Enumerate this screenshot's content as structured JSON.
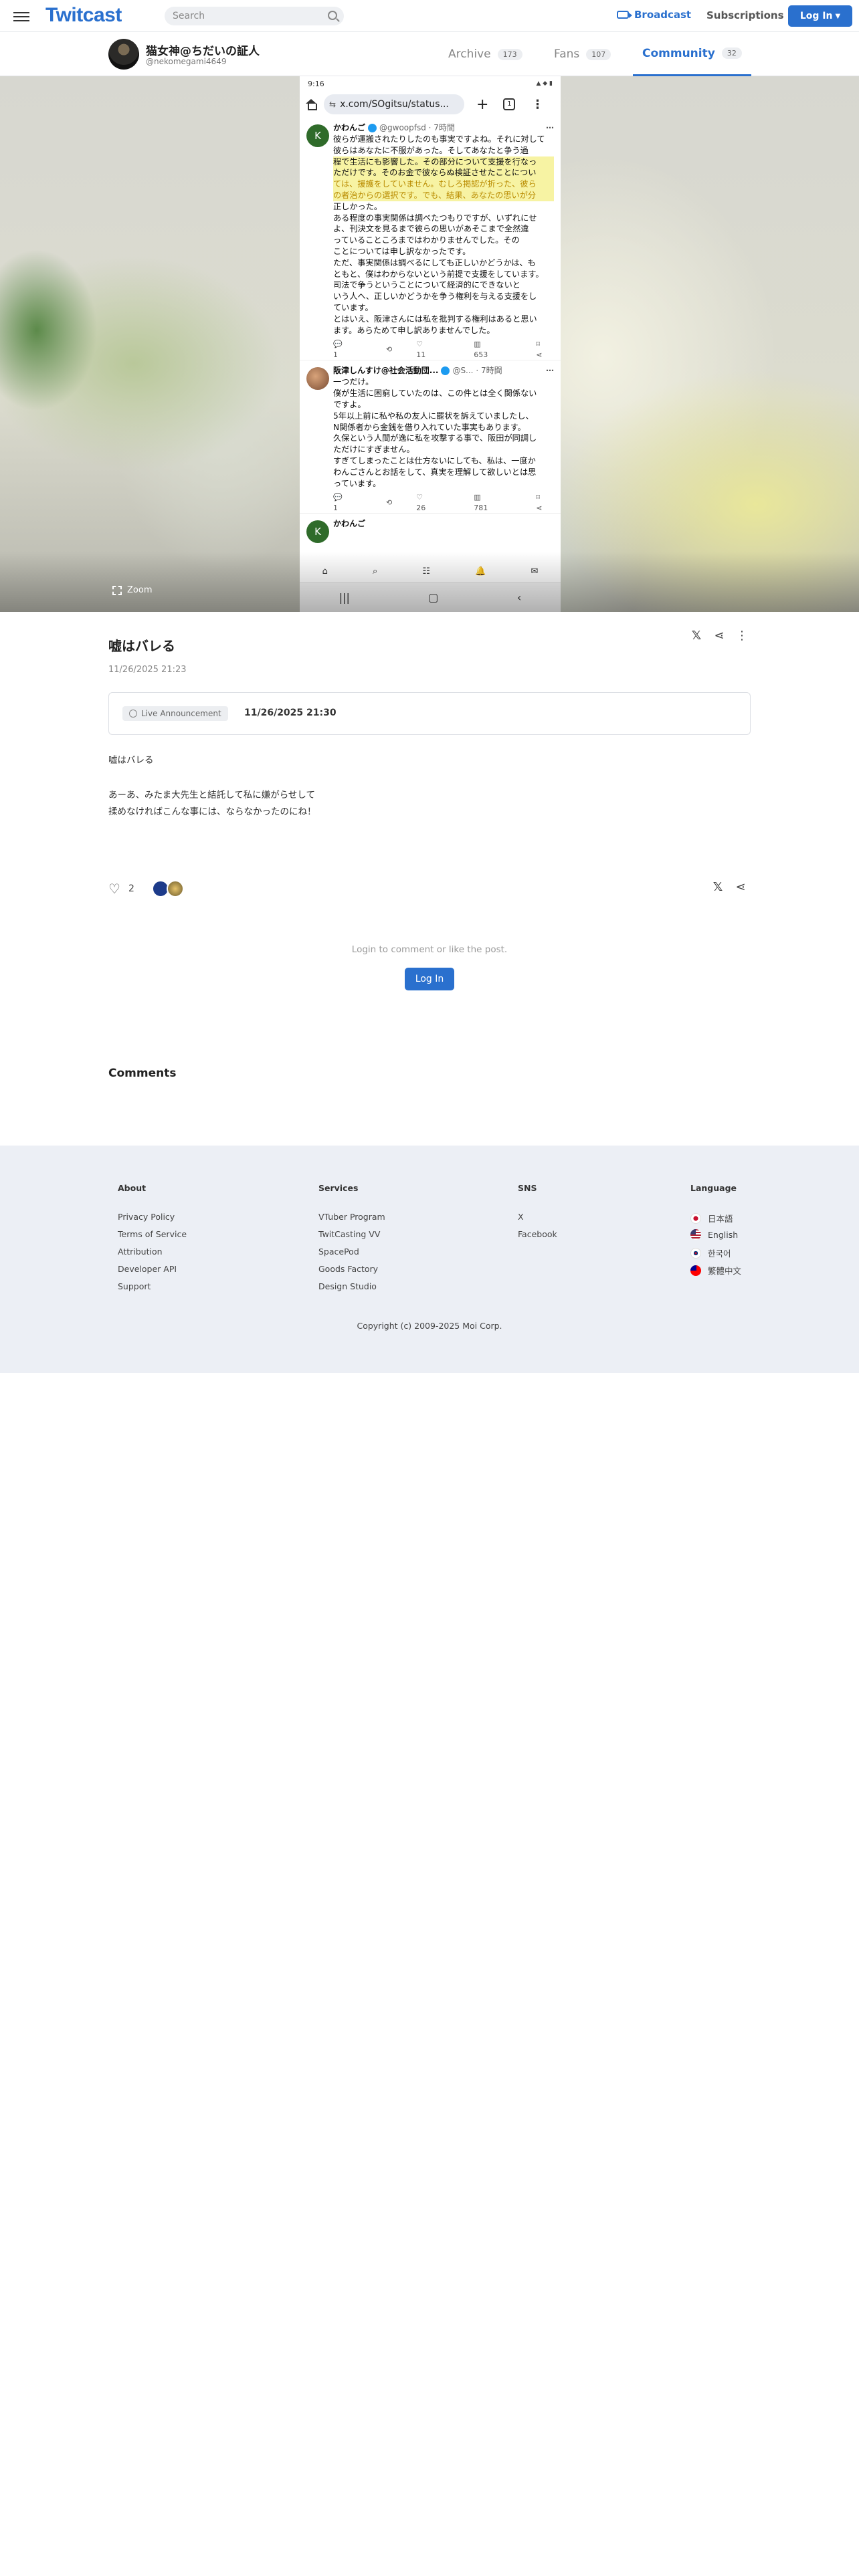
{
  "header": {
    "logo": "Twitcast",
    "search_placeholder": "Search",
    "broadcast": "Broadcast",
    "subscriptions": "Subscriptions",
    "login": "Log In"
  },
  "channel": {
    "name": "猫女神@ちだいの証人",
    "id": "@nekomegami4649",
    "tabs": [
      {
        "label": "Archive",
        "count": "173"
      },
      {
        "label": "Fans",
        "count": "107"
      },
      {
        "label": "Community",
        "count": "32"
      }
    ]
  },
  "hero": {
    "zoom": "Zoom",
    "phone": {
      "time": "9:16",
      "url": "x.com/SOgitsu/status...",
      "tabs_count": "1",
      "tweet1": {
        "avatar_letter": "K",
        "name": "かわんご",
        "handle": "@gwoopfsd · 7時間",
        "lines": [
          "彼らが運搬されたりしたのも事実ですよね。それに対して",
          "彼らはあなたに不服があった。そしてあなたと争う過",
          "程で生活にも影響した。その部分について支援を行なっ",
          "ただけです。そのお金で彼ならぬ検証させたことについ",
          "ては、援護をしていません。むしろ掲認が折った、彼ら",
          "の者治からの選択です。でも、結果、あなたの思いが分",
          "正しかった。",
          "ある程度の事実関係は調べたつもりですが、いずれにせ",
          "よ、刊決文を見るまで彼らの思いがあそこまで全然違",
          "っていることころまではわかりませんでした。その",
          "ことについては申し訳なかったです。",
          "ただ、事実関係は調べるにしても正しいかどうかは、も",
          "ともと、僕はわからないという前提で支援をしています。",
          "司法で争うということについて経済的にできないと",
          "いう人へ、正しいかどうかを争う権利を与える支援をし",
          "ています。",
          "とはいえ、阪津さんには私を批判する権利はあると思い",
          "ます。あらためて申し訳ありませんでした。"
        ],
        "stats": [
          "1",
          "",
          "11",
          "653"
        ]
      },
      "tweet2": {
        "name": "阪津しんすけ@社会活動団...",
        "handle": "@S... · 7時間",
        "lines": [
          "一つだけ。",
          "僕が生活に困窮していたのは、この件とは全く関係ない",
          "ですよ。",
          "5年以上前に私や私の友人に罷状を訴えていましたし、",
          "N関係者から金銭を借り入れていた事実もあります。",
          "久保という人間が逸に私を攻撃する事で、阪田が同調し",
          "ただけにすぎません。",
          "すぎてしまったことは仕方ないにしても、私は、一度か",
          "わんごさんとお話をして、真実を理解して欲しいとは思",
          "っています。"
        ],
        "stats": [
          "1",
          "",
          "26",
          "781"
        ]
      },
      "tweet3_head": "かわんご"
    }
  },
  "post": {
    "title": "嘘はバレる",
    "date": "11/26/2025 21:23",
    "live_label": "Live Announcement",
    "live_datetime": "11/26/2025 21:30",
    "body1": "嘘はバレる",
    "body2_line1": "あーあ、みたま大先生と結託して私に嫌がらせして",
    "body2_line2": "揉めなければこんな事には、ならなかったのにね！",
    "likes": "2"
  },
  "login_note": "Login to comment or like the post.",
  "login_button": "Log In",
  "comments_title": "Comments",
  "footer": {
    "about": {
      "title": "About",
      "items": [
        "Privacy Policy",
        "Terms of Service",
        "Attribution",
        "Developer API",
        "Support"
      ]
    },
    "services": {
      "title": "Services",
      "items": [
        "VTuber Program",
        "TwitCasting VV",
        "SpacePod",
        "Goods Factory",
        "Design Studio"
      ]
    },
    "sns": {
      "title": "SNS",
      "items": [
        "X",
        "Facebook"
      ]
    },
    "language": {
      "title": "Language",
      "items": [
        "日本語",
        "English",
        "한국어",
        "繁體中文"
      ]
    },
    "copyright": "Copyright (c) 2009-2025 Moi Corp."
  },
  "colors": {
    "accent": "#2a70ce"
  }
}
